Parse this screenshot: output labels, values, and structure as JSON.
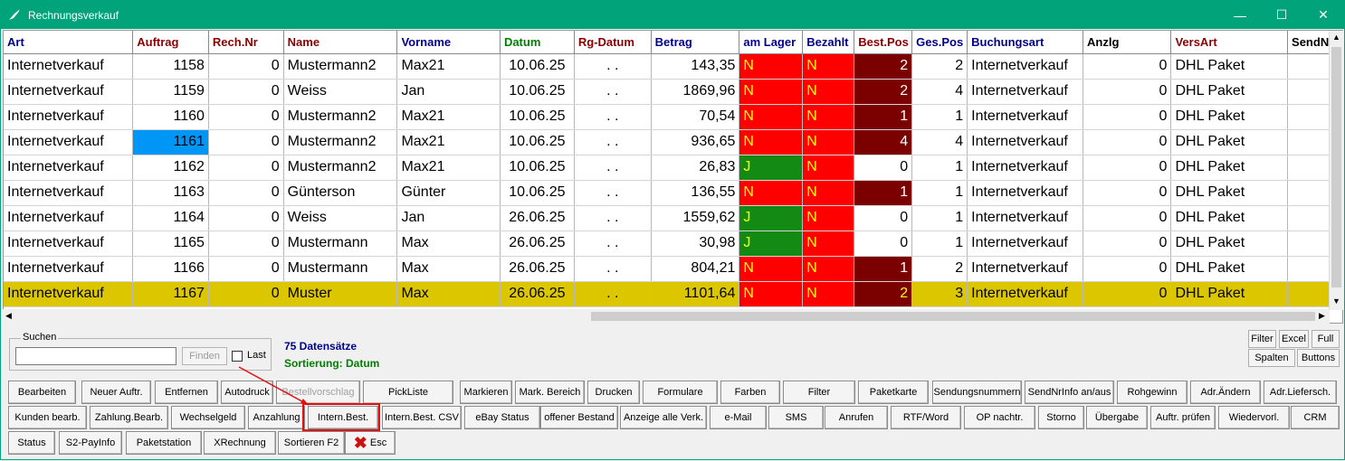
{
  "window": {
    "title": "Rechnungsverkauf",
    "controls": {
      "minimize": "—",
      "maximize": "☐",
      "close": "✕"
    }
  },
  "columns": [
    "Art",
    "Auftrag",
    "Rech.Nr",
    "Name",
    "Vorname",
    "Datum",
    "Rg-Datum",
    "Betrag",
    "am Lager",
    "Bezahlt",
    "Best.Pos",
    "Ges.Pos",
    "Buchungsart",
    "Anzlg",
    "VersArt",
    "SendN"
  ],
  "rows": [
    [
      "Internetverkauf",
      "1158",
      "0",
      "Mustermann2",
      "Max21",
      "10.06.25",
      ". .",
      "143,35",
      "N",
      "N",
      "2",
      "2",
      "Internetverkauf",
      "0",
      "DHL Paket"
    ],
    [
      "Internetverkauf",
      "1159",
      "0",
      "Weiss",
      "Jan",
      "10.06.25",
      ". .",
      "1869,96",
      "N",
      "N",
      "2",
      "4",
      "Internetverkauf",
      "0",
      "DHL Paket"
    ],
    [
      "Internetverkauf",
      "1160",
      "0",
      "Mustermann2",
      "Max21",
      "10.06.25",
      ". .",
      "70,54",
      "N",
      "N",
      "1",
      "1",
      "Internetverkauf",
      "0",
      "DHL Paket"
    ],
    [
      "Internetverkauf",
      "1161",
      "0",
      "Mustermann2",
      "Max21",
      "10.06.25",
      ". .",
      "936,65",
      "N",
      "N",
      "4",
      "4",
      "Internetverkauf",
      "0",
      "DHL Paket"
    ],
    [
      "Internetverkauf",
      "1162",
      "0",
      "Mustermann2",
      "Max21",
      "10.06.25",
      ". .",
      "26,83",
      "J",
      "N",
      "0",
      "1",
      "Internetverkauf",
      "0",
      "DHL Paket"
    ],
    [
      "Internetverkauf",
      "1163",
      "0",
      "Günterson",
      "Günter",
      "10.06.25",
      ". .",
      "136,55",
      "N",
      "N",
      "1",
      "1",
      "Internetverkauf",
      "0",
      "DHL Paket"
    ],
    [
      "Internetverkauf",
      "1164",
      "0",
      "Weiss",
      "Jan",
      "26.06.25",
      ". .",
      "1559,62",
      "J",
      "N",
      "0",
      "1",
      "Internetverkauf",
      "0",
      "DHL Paket"
    ],
    [
      "Internetverkauf",
      "1165",
      "0",
      "Mustermann",
      "Max",
      "26.06.25",
      ". .",
      "30,98",
      "J",
      "N",
      "0",
      "1",
      "Internetverkauf",
      "0",
      "DHL Paket"
    ],
    [
      "Internetverkauf",
      "1166",
      "0",
      "Mustermann",
      "Max",
      "26.06.25",
      ". .",
      "804,21",
      "N",
      "N",
      "1",
      "2",
      "Internetverkauf",
      "0",
      "DHL Paket"
    ],
    [
      "Internetverkauf",
      "1167",
      "0",
      "Muster",
      "Max",
      "26.06.25",
      ". .",
      "1101,64",
      "N",
      "N",
      "2",
      "3",
      "Internetverkauf",
      "0",
      "DHL Paket"
    ]
  ],
  "selected_row_index": 9,
  "current_cell": {
    "row": 3,
    "col": 1
  },
  "search": {
    "legend": "Suchen",
    "value": "",
    "find_label": "Finden",
    "last_label": "Last"
  },
  "status": {
    "count": "75 Datensätze",
    "sort": "Sortierung: Datum"
  },
  "small_buttons": {
    "filter": "Filter",
    "excel": "Excel",
    "full": "Full",
    "spalten": "Spalten",
    "buttons": "Buttons"
  },
  "buttons_row1": [
    "Bearbeiten",
    "Neuer Auftr.",
    "Entfernen",
    "Autodruck",
    "Bestellvorschlag",
    "PickListe",
    "Markieren",
    "Mark. Bereich",
    "Drucken",
    "Formulare",
    "Farben",
    "Filter",
    "Paketkarte",
    "Sendungsnummern",
    "SendNrInfo an/aus",
    "Rohgewinn",
    "Adr.Ändern",
    "Adr.Liefersch."
  ],
  "buttons_row2": [
    "Kunden bearb.",
    "Zahlung.Bearb.",
    "Wechselgeld",
    "Anzahlung",
    "Intern.Best.",
    "Intern.Best. CSV",
    "eBay Status",
    "offener Bestand",
    "Anzeige alle Verk.",
    "e-Mail",
    "SMS",
    "Anrufen",
    "RTF/Word",
    "OP nachtr.",
    "Storno",
    "Übergabe",
    "Auftr. prüfen",
    "Wiedervorl.",
    "CRM"
  ],
  "buttons_row3": [
    "Status",
    "S2-PayInfo",
    "Paketstation",
    "XRechnung",
    "Sortieren F2",
    "Esc"
  ],
  "colors": {
    "titlebar": "#00a37a",
    "selected_row": "#dcc600",
    "red_cell": "#ff0000",
    "green_cell": "#138a13",
    "darkred_cell": "#7b0000",
    "current_cell": "#0096f5",
    "highlight": "#e01010"
  }
}
